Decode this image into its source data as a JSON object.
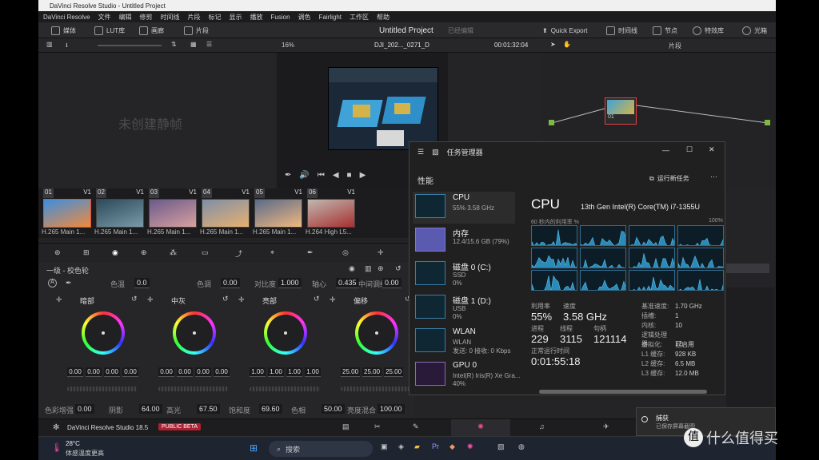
{
  "app_title": "DaVinci Resolve Studio - Untitled Project",
  "menu": [
    "DaVinci Resolve",
    "文件",
    "编辑",
    "修剪",
    "时间线",
    "片段",
    "标记",
    "显示",
    "播放",
    "Fusion",
    "调色",
    "Fairlight",
    "工作区",
    "帮助"
  ],
  "toolbar": {
    "media_pool": "媒体",
    "lut": "LUT库",
    "gallery": "画廊",
    "clips": "片段",
    "project_title": "Untitled Project",
    "project_status": "已经编辑",
    "quick_export": "Quick Export",
    "timeline": "时间线",
    "nodes": "节点",
    "effects": "特效库",
    "lightbox": "光箱"
  },
  "viewer": {
    "zoom": "16%",
    "clip_name": "DJI_202..._0271_D",
    "timecode": "00:01:32:04",
    "nodes_mode": "片段"
  },
  "gallery": {
    "empty_msg": "未创建静帧"
  },
  "clips": [
    {
      "num": "01",
      "track": "V1",
      "codec": "H.265 Main 1...",
      "c1": "#3d8fe0",
      "c2": "#f08a3c"
    },
    {
      "num": "02",
      "track": "V1",
      "codec": "H.265 Main 1...",
      "c1": "#2c4a5a",
      "c2": "#7a9aa8"
    },
    {
      "num": "03",
      "track": "V1",
      "codec": "H.265 Main 1...",
      "c1": "#6a5a8a",
      "c2": "#d9a0a0"
    },
    {
      "num": "04",
      "track": "V1",
      "codec": "H.265 Main 1...",
      "c1": "#7f8fa8",
      "c2": "#e8b070"
    },
    {
      "num": "05",
      "track": "V1",
      "codec": "H.265 Main 1...",
      "c1": "#5a6a8a",
      "c2": "#f0b880"
    },
    {
      "num": "06",
      "track": "V1",
      "codec": "H.264 High L5...",
      "c1": "#c0b8b0",
      "c2": "#a83030"
    }
  ],
  "node": {
    "label": "01"
  },
  "color": {
    "panel_title": "一级 - 校色轮",
    "params": [
      {
        "label": "色温",
        "value": "0.0"
      },
      {
        "label": "色调",
        "value": "0.00"
      },
      {
        "label": "对比度",
        "value": "1.000"
      },
      {
        "label": "轴心",
        "value": "0.435"
      },
      {
        "label": "中间调细节",
        "value": "0.00"
      }
    ],
    "wheels": [
      {
        "label": "暗部",
        "values": [
          "0.00",
          "0.00",
          "0.00",
          "0.00"
        ]
      },
      {
        "label": "中灰",
        "values": [
          "0.00",
          "0.00",
          "0.00",
          "0.00"
        ]
      },
      {
        "label": "亮部",
        "values": [
          "1.00",
          "1.00",
          "1.00",
          "1.00"
        ]
      },
      {
        "label": "偏移",
        "values": [
          "25.00",
          "25.00",
          "25.00"
        ]
      }
    ],
    "bottom": [
      {
        "label": "色彩增强",
        "value": "0.00"
      },
      {
        "label": "阴影",
        "value": "64.00"
      },
      {
        "label": "高光",
        "value": "67.50"
      },
      {
        "label": "饱和度",
        "value": "69.60"
      },
      {
        "label": "色相",
        "value": "50.00"
      },
      {
        "label": "亮度混合",
        "value": "100.00"
      }
    ]
  },
  "pagebar": {
    "app": "DaVinci Resolve Studio 18.5",
    "badge": "PUBLIC BETA"
  },
  "taskbar": {
    "temp": "28°C",
    "weather": "体感温度更高",
    "search": "搜索"
  },
  "taskmgr": {
    "title": "任务管理器",
    "section": "性能",
    "run_task": "运行新任务",
    "items": [
      {
        "name": "CPU",
        "s1": "55% 3.58 GHz",
        "s2": ""
      },
      {
        "name": "内存",
        "s1": "12.4/15.6 GB (79%)",
        "s2": ""
      },
      {
        "name": "磁盘 0 (C:)",
        "s1": "SSD",
        "s2": "0%"
      },
      {
        "name": "磁盘 1 (D:)",
        "s1": "USB",
        "s2": "0%"
      },
      {
        "name": "WLAN",
        "s1": "WLAN",
        "s2": "发送: 0 接收: 0 Kbps"
      },
      {
        "name": "GPU 0",
        "s1": "Intel(R) Iris(R) Xe Gra...",
        "s2": "40%"
      }
    ],
    "cpu_title": "CPU",
    "cpu_model": "13th Gen Intel(R) Core(TM) i7-1355U",
    "graph_caption": "60 秒内的利用率 %",
    "graph_max": "100%",
    "stats": [
      {
        "label": "利用率",
        "value": "55%"
      },
      {
        "label": "速度",
        "value": "3.58 GHz"
      },
      {
        "label": "进程",
        "value": "229"
      },
      {
        "label": "线程",
        "value": "3115"
      },
      {
        "label": "句柄",
        "value": "121114"
      },
      {
        "label": "正常运行时间",
        "value": "0:01:55:18"
      }
    ],
    "specs": [
      {
        "k": "基准速度:",
        "v": "1.70 GHz"
      },
      {
        "k": "插槽:",
        "v": "1"
      },
      {
        "k": "内核:",
        "v": "10"
      },
      {
        "k": "逻辑处理器:",
        "v": "12"
      },
      {
        "k": "虚拟化:",
        "v": "已启用"
      },
      {
        "k": "L1 缓存:",
        "v": "928 KB"
      },
      {
        "k": "L2 缓存:",
        "v": "6.5 MB"
      },
      {
        "k": "L3 缓存:",
        "v": "12.0 MB"
      }
    ]
  },
  "notification": {
    "title": "捕获",
    "body": "已保存屏幕截图"
  },
  "watermark": "什么值得买"
}
